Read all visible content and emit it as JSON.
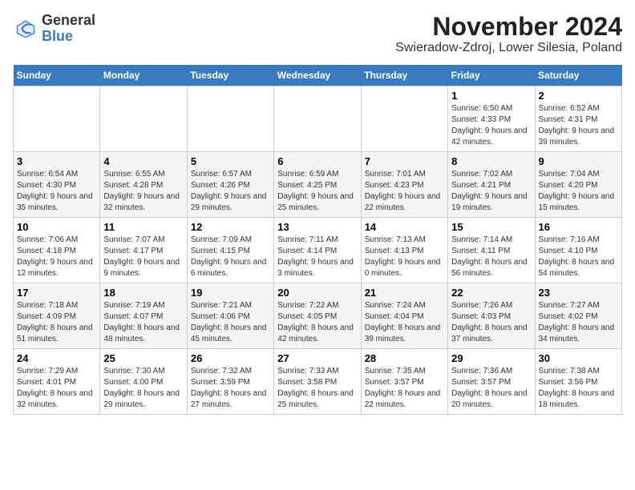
{
  "header": {
    "logo_general": "General",
    "logo_blue": "Blue",
    "title": "November 2024",
    "subtitle": "Swieradow-Zdroj, Lower Silesia, Poland"
  },
  "days_of_week": [
    "Sunday",
    "Monday",
    "Tuesday",
    "Wednesday",
    "Thursday",
    "Friday",
    "Saturday"
  ],
  "weeks": [
    [
      {
        "day": "",
        "details": ""
      },
      {
        "day": "",
        "details": ""
      },
      {
        "day": "",
        "details": ""
      },
      {
        "day": "",
        "details": ""
      },
      {
        "day": "",
        "details": ""
      },
      {
        "day": "1",
        "details": "Sunrise: 6:50 AM\nSunset: 4:33 PM\nDaylight: 9 hours and 42 minutes."
      },
      {
        "day": "2",
        "details": "Sunrise: 6:52 AM\nSunset: 4:31 PM\nDaylight: 9 hours and 39 minutes."
      }
    ],
    [
      {
        "day": "3",
        "details": "Sunrise: 6:54 AM\nSunset: 4:30 PM\nDaylight: 9 hours and 35 minutes."
      },
      {
        "day": "4",
        "details": "Sunrise: 6:55 AM\nSunset: 4:28 PM\nDaylight: 9 hours and 32 minutes."
      },
      {
        "day": "5",
        "details": "Sunrise: 6:57 AM\nSunset: 4:26 PM\nDaylight: 9 hours and 29 minutes."
      },
      {
        "day": "6",
        "details": "Sunrise: 6:59 AM\nSunset: 4:25 PM\nDaylight: 9 hours and 25 minutes."
      },
      {
        "day": "7",
        "details": "Sunrise: 7:01 AM\nSunset: 4:23 PM\nDaylight: 9 hours and 22 minutes."
      },
      {
        "day": "8",
        "details": "Sunrise: 7:02 AM\nSunset: 4:21 PM\nDaylight: 9 hours and 19 minutes."
      },
      {
        "day": "9",
        "details": "Sunrise: 7:04 AM\nSunset: 4:20 PM\nDaylight: 9 hours and 15 minutes."
      }
    ],
    [
      {
        "day": "10",
        "details": "Sunrise: 7:06 AM\nSunset: 4:18 PM\nDaylight: 9 hours and 12 minutes."
      },
      {
        "day": "11",
        "details": "Sunrise: 7:07 AM\nSunset: 4:17 PM\nDaylight: 9 hours and 9 minutes."
      },
      {
        "day": "12",
        "details": "Sunrise: 7:09 AM\nSunset: 4:15 PM\nDaylight: 9 hours and 6 minutes."
      },
      {
        "day": "13",
        "details": "Sunrise: 7:11 AM\nSunset: 4:14 PM\nDaylight: 9 hours and 3 minutes."
      },
      {
        "day": "14",
        "details": "Sunrise: 7:13 AM\nSunset: 4:13 PM\nDaylight: 9 hours and 0 minutes."
      },
      {
        "day": "15",
        "details": "Sunrise: 7:14 AM\nSunset: 4:11 PM\nDaylight: 8 hours and 56 minutes."
      },
      {
        "day": "16",
        "details": "Sunrise: 7:16 AM\nSunset: 4:10 PM\nDaylight: 8 hours and 54 minutes."
      }
    ],
    [
      {
        "day": "17",
        "details": "Sunrise: 7:18 AM\nSunset: 4:09 PM\nDaylight: 8 hours and 51 minutes."
      },
      {
        "day": "18",
        "details": "Sunrise: 7:19 AM\nSunset: 4:07 PM\nDaylight: 8 hours and 48 minutes."
      },
      {
        "day": "19",
        "details": "Sunrise: 7:21 AM\nSunset: 4:06 PM\nDaylight: 8 hours and 45 minutes."
      },
      {
        "day": "20",
        "details": "Sunrise: 7:22 AM\nSunset: 4:05 PM\nDaylight: 8 hours and 42 minutes."
      },
      {
        "day": "21",
        "details": "Sunrise: 7:24 AM\nSunset: 4:04 PM\nDaylight: 8 hours and 39 minutes."
      },
      {
        "day": "22",
        "details": "Sunrise: 7:26 AM\nSunset: 4:03 PM\nDaylight: 8 hours and 37 minutes."
      },
      {
        "day": "23",
        "details": "Sunrise: 7:27 AM\nSunset: 4:02 PM\nDaylight: 8 hours and 34 minutes."
      }
    ],
    [
      {
        "day": "24",
        "details": "Sunrise: 7:29 AM\nSunset: 4:01 PM\nDaylight: 8 hours and 32 minutes."
      },
      {
        "day": "25",
        "details": "Sunrise: 7:30 AM\nSunset: 4:00 PM\nDaylight: 8 hours and 29 minutes."
      },
      {
        "day": "26",
        "details": "Sunrise: 7:32 AM\nSunset: 3:59 PM\nDaylight: 8 hours and 27 minutes."
      },
      {
        "day": "27",
        "details": "Sunrise: 7:33 AM\nSunset: 3:58 PM\nDaylight: 8 hours and 25 minutes."
      },
      {
        "day": "28",
        "details": "Sunrise: 7:35 AM\nSunset: 3:57 PM\nDaylight: 8 hours and 22 minutes."
      },
      {
        "day": "29",
        "details": "Sunrise: 7:36 AM\nSunset: 3:57 PM\nDaylight: 8 hours and 20 minutes."
      },
      {
        "day": "30",
        "details": "Sunrise: 7:38 AM\nSunset: 3:56 PM\nDaylight: 8 hours and 18 minutes."
      }
    ]
  ]
}
